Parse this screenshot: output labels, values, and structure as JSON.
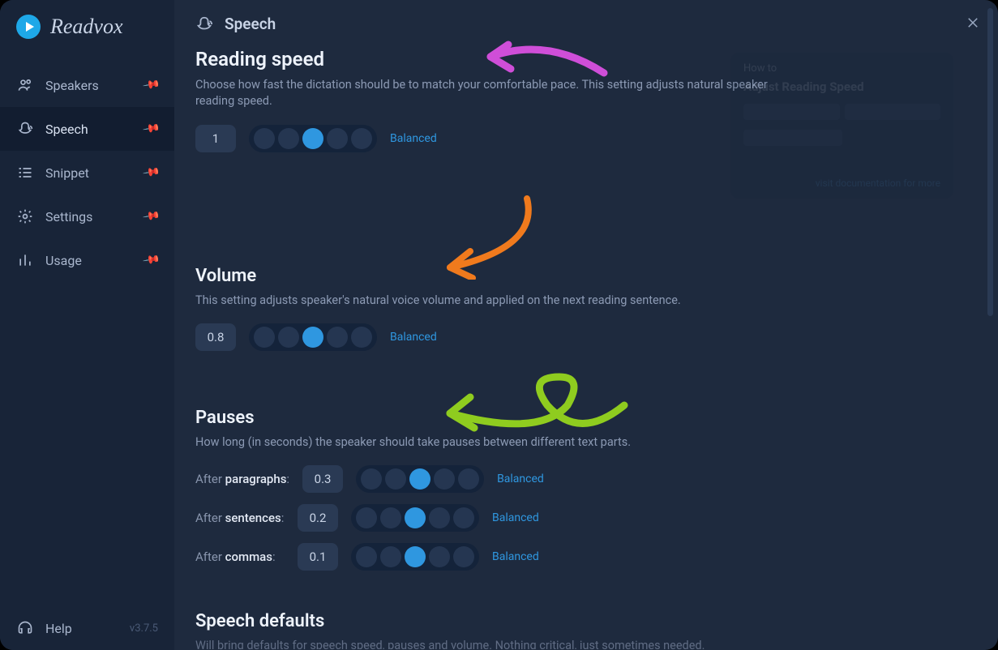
{
  "app": {
    "name": "Readvox",
    "version": "v3.7.5"
  },
  "sidebar": {
    "items": [
      {
        "label": "Speakers",
        "pinned": true
      },
      {
        "label": "Speech",
        "pinned": true
      },
      {
        "label": "Snippet",
        "pinned": true
      },
      {
        "label": "Settings",
        "pinned": false
      },
      {
        "label": "Usage",
        "pinned": false
      }
    ],
    "help": "Help"
  },
  "header": {
    "title": "Speech"
  },
  "sections": {
    "speed": {
      "title": "Reading speed",
      "desc": "Choose how fast the dictation should be to match your comfortable pace. This setting adjusts natural speaker reading speed.",
      "value": "1",
      "level_label": "Balanced",
      "level_index": 2
    },
    "volume": {
      "title": "Volume",
      "desc": "This setting adjusts speaker's natural voice volume and applied on the next reading sentence.",
      "value": "0.8",
      "level_label": "Balanced",
      "level_index": 2
    },
    "pauses": {
      "title": "Pauses",
      "desc": "How long (in seconds) the speaker should take pauses between different text parts.",
      "rows": [
        {
          "prefix": "After ",
          "strong": "paragraphs",
          "suffix": ":",
          "value": "0.3",
          "level_label": "Balanced",
          "level_index": 2
        },
        {
          "prefix": "After ",
          "strong": "sentences",
          "suffix": ":",
          "value": "0.2",
          "level_label": "Balanced",
          "level_index": 2
        },
        {
          "prefix": "After ",
          "strong": "commas",
          "suffix": ":",
          "value": "0.1",
          "level_label": "Balanced",
          "level_index": 2
        }
      ]
    },
    "defaults": {
      "title": "Speech defaults",
      "desc": "Will bring defaults for speech speed, pauses and volume. Nothing critical, just sometimes needed."
    }
  },
  "overlay": {
    "line1": "How to",
    "line2": "Adjust Reading Speed",
    "link": "visit documentation for more"
  },
  "annotations": {
    "arrow_speed_color": "#cf4ed8",
    "arrow_volume_color": "#f07a1d",
    "arrow_pauses_color": "#8fcc1f"
  }
}
